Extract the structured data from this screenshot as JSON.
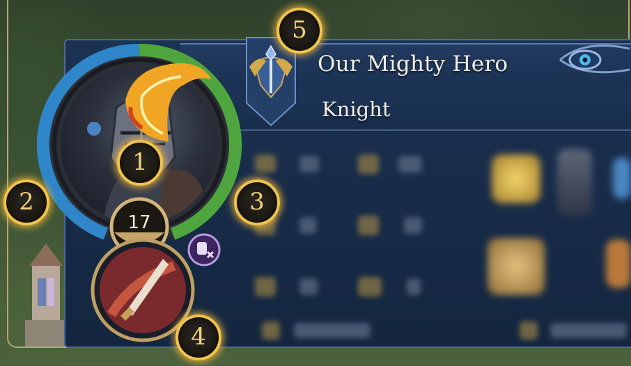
{
  "hero": {
    "name": "Our Mighty Hero",
    "class": "Knight",
    "level": "17"
  },
  "markers": [
    {
      "id": 1,
      "label": "1"
    },
    {
      "id": 2,
      "label": "2"
    },
    {
      "id": 3,
      "label": "3"
    },
    {
      "id": 4,
      "label": "4"
    },
    {
      "id": 5,
      "label": "5"
    }
  ],
  "colors": {
    "health_ring": "#2f86c8",
    "experience_ring": "#4fa63f",
    "marker_glow": "#f0c44a",
    "panel": "#1c3252",
    "panel_border": "#4a6a98"
  },
  "icons": {
    "emblem": "knight-crest-icon",
    "ornament": "eye-ornament-icon",
    "skill": "dagger-skill-icon",
    "status": "helmet-x-icon"
  }
}
